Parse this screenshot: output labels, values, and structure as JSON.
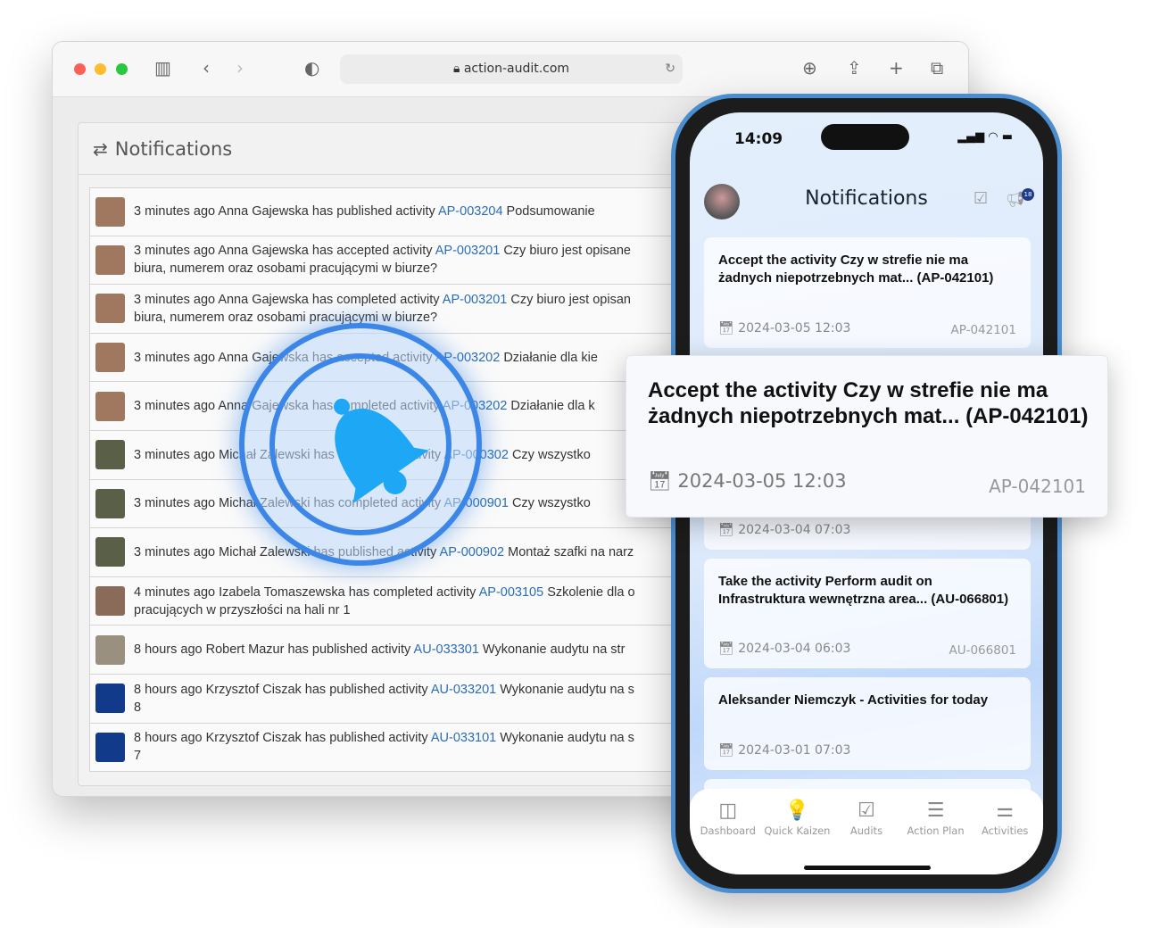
{
  "browser": {
    "url": "action-audit.com"
  },
  "panel": {
    "title": "Notifications"
  },
  "notifications": [
    {
      "pre": "3 minutes ago Anna Gajewska has published activity ",
      "code": "AP-003204",
      "post": " Podsumowanie",
      "avatar": "#a07860"
    },
    {
      "pre": "3 minutes ago Anna Gajewska has accepted activity ",
      "code": "AP-003201",
      "post": " Czy biuro jest opisane\nbiura, numerem oraz osobami pracującymi w biurze?",
      "avatar": "#a07860"
    },
    {
      "pre": "3 minutes ago Anna Gajewska has completed activity ",
      "code": "AP-003201",
      "post": " Czy biuro jest opisan\nbiura, numerem oraz osobami pracującymi w biurze?",
      "avatar": "#a07860"
    },
    {
      "pre": "3 minutes ago Anna Gajewska has accepted activity ",
      "code": "AP-003202",
      "post": " Działanie dla kie",
      "avatar": "#a07860"
    },
    {
      "pre": "3 minutes ago Anna Gajewska has completed activity ",
      "code": "AP-003202",
      "post": " Działanie dla k",
      "avatar": "#a07860"
    },
    {
      "pre": "3 minutes ago Michał Zalewski has completed activity ",
      "code": "AP-000302",
      "post": " Czy wszystko",
      "avatar": "#5a6048"
    },
    {
      "pre": "3 minutes ago Michał Zalewski has completed activity ",
      "code": "AP-000901",
      "post": " Czy wszystko",
      "avatar": "#5a6048"
    },
    {
      "pre": "3 minutes ago Michał Zalewski has published activity ",
      "code": "AP-000902",
      "post": " Montaż szafki na narz",
      "avatar": "#5a6048"
    },
    {
      "pre": "4 minutes ago Izabela Tomaszewska has completed activity ",
      "code": "AP-003105",
      "post": " Szkolenie dla o\npracujących w przyszłości na hali nr 1",
      "avatar": "#8a6a58"
    },
    {
      "pre": "8 hours ago Robert Mazur has published activity ",
      "code": "AU-033301",
      "post": " Wykonanie audytu na str",
      "avatar": "#9a9080"
    },
    {
      "pre": "8 hours ago Krzysztof Ciszak has published activity ",
      "code": "AU-033201",
      "post": " Wykonanie audytu na s\n8",
      "avatar": "#123a8a"
    },
    {
      "pre": "8 hours ago Krzysztof Ciszak has published activity ",
      "code": "AU-033101",
      "post": " Wykonanie audytu na s\n7",
      "avatar": "#123a8a"
    }
  ],
  "phone": {
    "time": "14:09",
    "title": "Notifications",
    "badge": "18",
    "cards": [
      {
        "title": "Accept the activity Czy w strefie nie ma żadnych niepotrzebnych mat... (AP-042101)",
        "date": "2024-03-05 12:03",
        "code": "AP-042101"
      },
      {
        "title": "",
        "date": "2024-03-04 07:03",
        "code": ""
      },
      {
        "title": "Take the activity Perform audit on Infrastruktura wewnętrzna area... (AU-066801)",
        "date": "2024-03-04 06:03",
        "code": "AU-066801"
      },
      {
        "title": "Aleksander Niemczyk - Activities for today",
        "date": "2024-03-01 07:03",
        "code": ""
      }
    ],
    "nav": [
      {
        "label": "Dashboard",
        "icon": "◫"
      },
      {
        "label": "Quick Kaizen",
        "icon": "💡"
      },
      {
        "label": "Audits",
        "icon": "☑"
      },
      {
        "label": "Action Plan",
        "icon": "☰"
      },
      {
        "label": "Activities",
        "icon": "⚌"
      }
    ]
  },
  "popup": {
    "title": "Accept the activity Czy w strefie nie ma żadnych niepotrzebnych mat... (AP-042101)",
    "date": "2024-03-05 12:03",
    "code": "AP-042101"
  },
  "colors": {
    "link": "#2a6db5",
    "accent": "#3b86e6",
    "bell": "#1ea7f5"
  }
}
